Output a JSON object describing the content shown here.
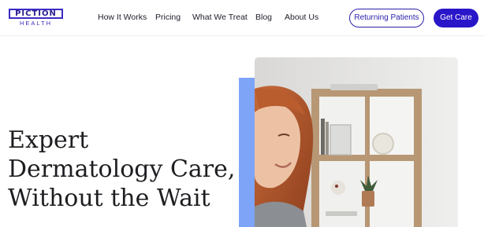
{
  "brand": {
    "name_top": "PICTION",
    "name_bottom": "HEALTH",
    "color": "#3b2bc4"
  },
  "nav": {
    "items": [
      {
        "label": "How It Works"
      },
      {
        "label": "Pricing"
      },
      {
        "label": "What We Treat"
      },
      {
        "label": "Blog"
      },
      {
        "label": "About Us"
      }
    ],
    "returning_label": "Returning Patients",
    "cta_label": "Get Care"
  },
  "hero": {
    "headline": "Expert Dermatology Care, Without the Wait",
    "accent_color": "#7da4f7",
    "image_subject": "woman-at-desk-with-shelves"
  },
  "colors": {
    "primary": "#2a16c9",
    "text": "#1e1e22"
  }
}
